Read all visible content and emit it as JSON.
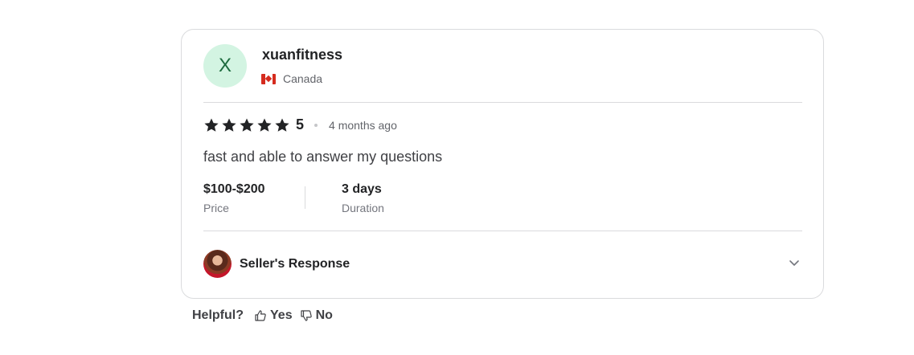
{
  "review": {
    "avatar_initial": "X",
    "username": "xuanfitness",
    "country": "Canada",
    "rating": "5",
    "stars_filled": 5,
    "time_ago": "4 months ago",
    "text": "fast and able to answer my questions",
    "price": {
      "value": "$100-$200",
      "label": "Price"
    },
    "duration": {
      "value": "3 days",
      "label": "Duration"
    },
    "seller_response_label": "Seller's Response"
  },
  "helpful": {
    "label": "Helpful?",
    "yes_label": "Yes",
    "no_label": "No"
  },
  "colors": {
    "avatar_bg": "#d3f4e2",
    "avatar_text": "#1d6b3e",
    "star": "#222325",
    "border": "#dadbdd"
  },
  "icons": {
    "flag": "canada-flag-icon",
    "star": "star-icon",
    "chevron": "chevron-down-icon",
    "thumb_up": "thumb-up-icon",
    "thumb_down": "thumb-down-icon"
  }
}
